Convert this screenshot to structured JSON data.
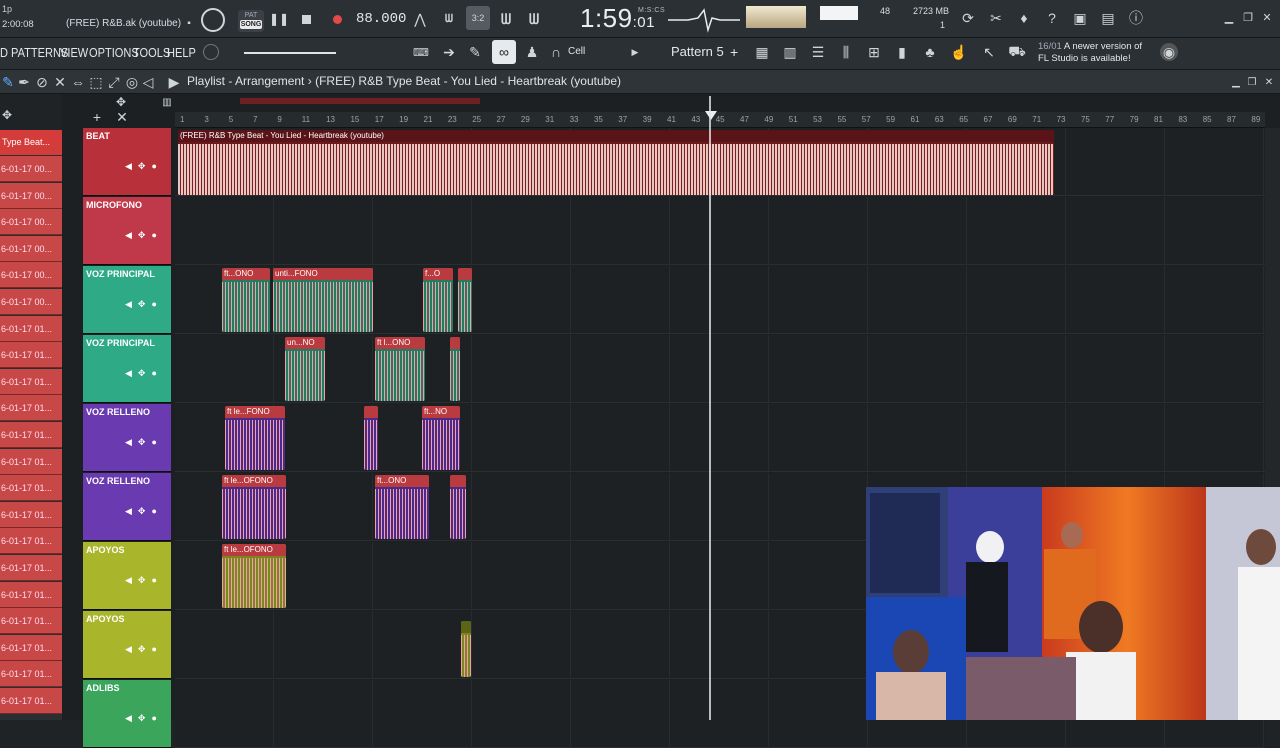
{
  "app": {
    "song_title": "(FREE) R&B.ak (youtube)",
    "time_left": "1p",
    "time_small": "2:00:08",
    "song_button_top": "PAT",
    "song_button_label": "SONG",
    "tempo": "88.000",
    "clock_main": "1:59",
    "clock_sub": ":01",
    "clock_unit": "M:S:CS",
    "cpu_value": "48",
    "memory": "2723 MB",
    "voices": "1",
    "news_date": "16/01",
    "news_line1": "A newer version of",
    "news_line2": "FL Studio is available!"
  },
  "menu": {
    "items": [
      "D PATTERNS",
      "VIEW",
      "OPTIONS",
      "TOOLS",
      "HELP"
    ],
    "snap": "Cell",
    "pattern": "Pattern 5",
    "add_pattern": "+"
  },
  "playlist": {
    "breadcrumb": "Playlist - Arrangement",
    "separator": "›",
    "title": "(FREE) R&B Type Beat - You Lied - Heartbreak (youtube)",
    "picker_selected": "Type Beat...",
    "picker_items": [
      "6-01-17 00...",
      "6-01-17 00...",
      "6-01-17 00...",
      "6-01-17 00...",
      "6-01-17 00...",
      "6-01-17 00...",
      "6-01-17 01...",
      "6-01-17 01...",
      "6-01-17 01...",
      "6-01-17 01...",
      "6-01-17 01...",
      "6-01-17 01...",
      "6-01-17 01...",
      "6-01-17 01...",
      "6-01-17 01...",
      "6-01-17 01...",
      "6-01-17 01...",
      "6-01-17 01...",
      "6-01-17 01...",
      "6-01-17 01...",
      "6-01-17 01..."
    ],
    "ruler": [
      "1",
      "3",
      "5",
      "7",
      "9",
      "11",
      "13",
      "15",
      "17",
      "19",
      "21",
      "23",
      "25",
      "27",
      "29",
      "31",
      "33",
      "35",
      "37",
      "39",
      "41",
      "43",
      "45",
      "47",
      "49",
      "51",
      "53",
      "55",
      "57",
      "59",
      "61",
      "63",
      "65",
      "67",
      "69",
      "71",
      "73",
      "75",
      "77",
      "79",
      "81",
      "83",
      "85",
      "87",
      "89"
    ],
    "tracks": [
      {
        "name": "BEAT",
        "color": "#b8313a"
      },
      {
        "name": "MICROFONO",
        "color": "#c0394a"
      },
      {
        "name": "VOZ PRINCIPAL",
        "color": "#2faa86"
      },
      {
        "name": "VOZ PRINCIPAL",
        "color": "#2faa86"
      },
      {
        "name": "VOZ RELLENO",
        "color": "#6a3ab0"
      },
      {
        "name": "VOZ RELLENO",
        "color": "#6a3ab0"
      },
      {
        "name": "APOYOS",
        "color": "#a9b52a"
      },
      {
        "name": "APOYOS",
        "color": "#a9b52a"
      },
      {
        "name": "ADLIBS",
        "color": "#3aa55b"
      }
    ],
    "clips": {
      "beat": "(FREE) R&B Type Beat - You Lied - Heartbreak (youtube)",
      "vp1a": "ft...ONO",
      "vp1b": "unti...FONO",
      "vp1c": "f...O",
      "vp2a": "un...NO",
      "vp2b": "ft l...ONO",
      "vr1a": "ft le...FONO",
      "vr1b": "ft...NO",
      "vr2a": "ft le...OFONO",
      "vr2b": "ft...ONO",
      "ap1a": "ft le...OFONO"
    }
  }
}
